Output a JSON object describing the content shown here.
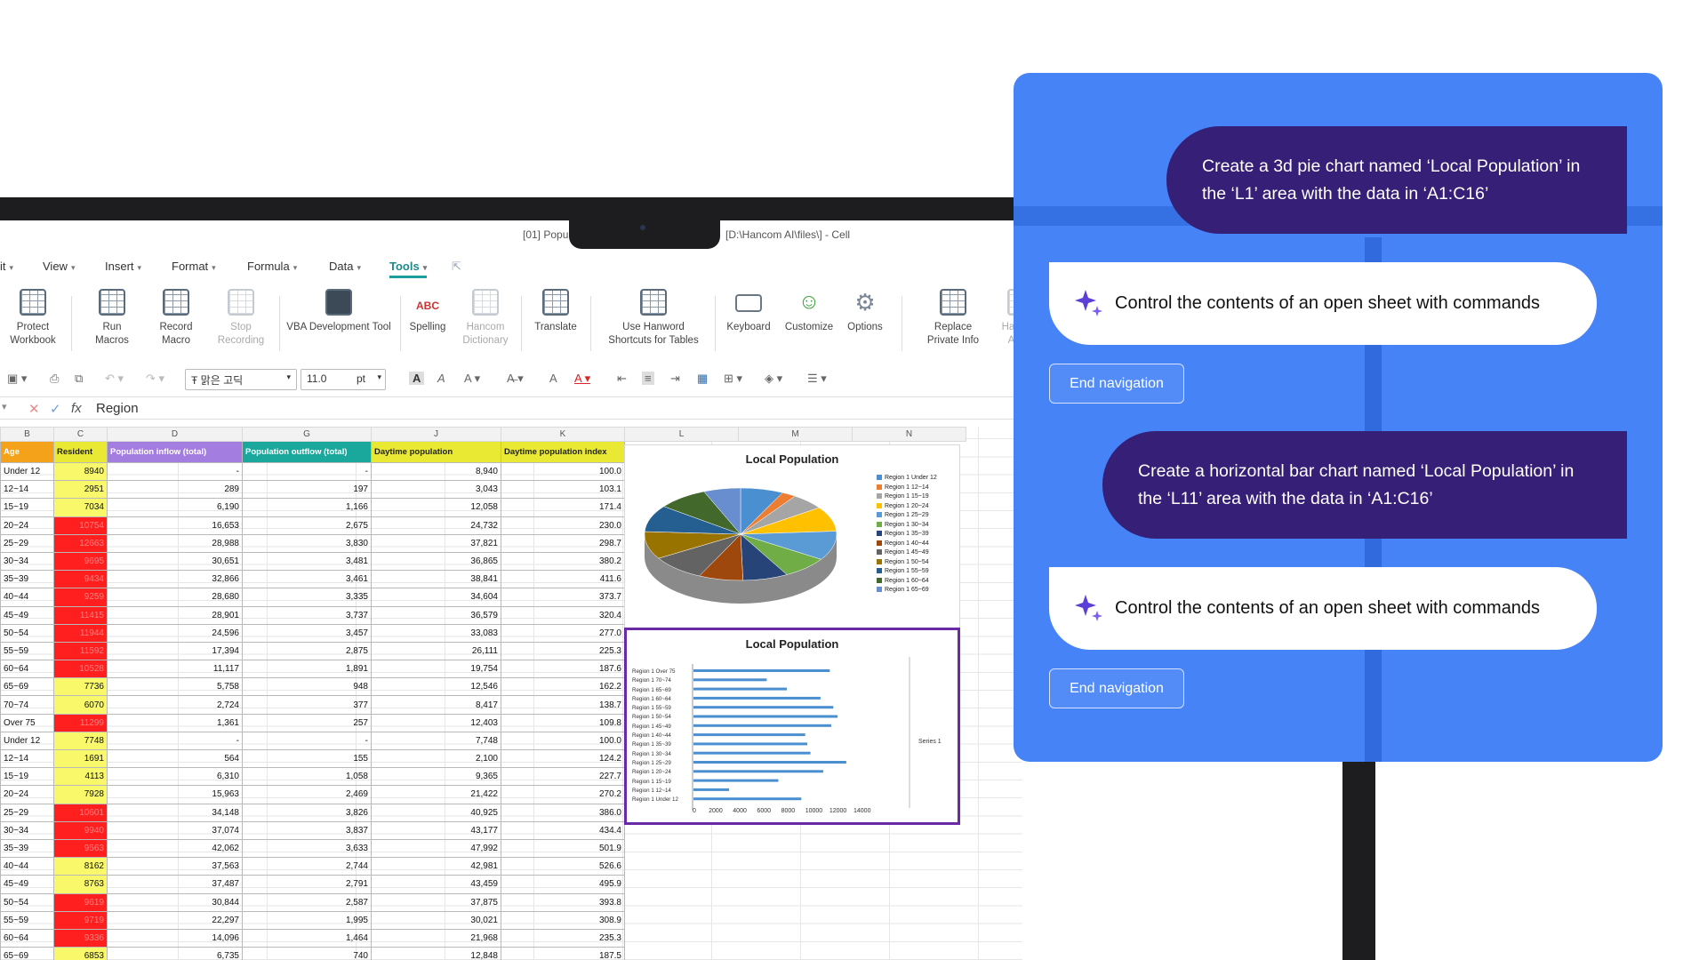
{
  "window": {
    "title_left": "[01] Popu",
    "title_right": "[D:\\Hancom AI\\files\\] - Cell"
  },
  "menu": {
    "items": [
      "it",
      "View",
      "Insert",
      "Format",
      "Formula",
      "Data",
      "Tools"
    ],
    "active": "Tools"
  },
  "ribbon": {
    "protect_workbook": "Protect Workbook",
    "run_macros": "Run Macros",
    "record_macro": "Record Macro",
    "stop_recording": "Stop Recording",
    "vba_tool": "VBA Development Tool",
    "spelling": "Spelling",
    "hancom_dictionary": "Hancom Dictionary",
    "translate": "Translate",
    "hanword_shortcuts": "Use Hanword Shortcuts for Tables",
    "keyboard": "Keyboard",
    "customize": "Customize",
    "options": "Options",
    "replace_private_info": "Replace Private Info",
    "hancom_asset": "Hancom Asset"
  },
  "toolbar": {
    "font_name": "맑은 고딕",
    "font_size": "11.0",
    "font_unit": "pt"
  },
  "formula_bar": {
    "value": "Region"
  },
  "sheet": {
    "column_letters": [
      "B",
      "C",
      "D",
      "G",
      "J",
      "K",
      "L",
      "M",
      "N"
    ],
    "headers": [
      "Age",
      "Resident",
      "Population inflow (total)",
      "Population outflow (total)",
      "Daytime population",
      "Daytime population index"
    ],
    "rows": [
      [
        "Under 12",
        "8940",
        "-",
        "-",
        "8,940",
        "100.0"
      ],
      [
        "12~14",
        "2951",
        "289",
        "197",
        "3,043",
        "103.1"
      ],
      [
        "15~19",
        "7034",
        "6,190",
        "1,166",
        "12,058",
        "171.4"
      ],
      [
        "20~24",
        "10754",
        "16,653",
        "2,675",
        "24,732",
        "230.0"
      ],
      [
        "25~29",
        "12663",
        "28,988",
        "3,830",
        "37,821",
        "298.7"
      ],
      [
        "30~34",
        "9695",
        "30,651",
        "3,481",
        "36,865",
        "380.2"
      ],
      [
        "35~39",
        "9434",
        "32,866",
        "3,461",
        "38,841",
        "411.6"
      ],
      [
        "40~44",
        "9259",
        "28,680",
        "3,335",
        "34,604",
        "373.7"
      ],
      [
        "45~49",
        "11415",
        "28,901",
        "3,737",
        "36,579",
        "320.4"
      ],
      [
        "50~54",
        "11944",
        "24,596",
        "3,457",
        "33,083",
        "277.0"
      ],
      [
        "55~59",
        "11592",
        "17,394",
        "2,875",
        "26,111",
        "225.3"
      ],
      [
        "60~64",
        "10528",
        "11,117",
        "1,891",
        "19,754",
        "187.6"
      ],
      [
        "65~69",
        "7736",
        "5,758",
        "948",
        "12,546",
        "162.2"
      ],
      [
        "70~74",
        "6070",
        "2,724",
        "377",
        "8,417",
        "138.7"
      ],
      [
        "Over 75",
        "11299",
        "1,361",
        "257",
        "12,403",
        "109.8"
      ],
      [
        "Under 12",
        "7748",
        "-",
        "-",
        "7,748",
        "100.0"
      ],
      [
        "12~14",
        "1691",
        "564",
        "155",
        "2,100",
        "124.2"
      ],
      [
        "15~19",
        "4113",
        "6,310",
        "1,058",
        "9,365",
        "227.7"
      ],
      [
        "20~24",
        "7928",
        "15,963",
        "2,469",
        "21,422",
        "270.2"
      ],
      [
        "25~29",
        "10601",
        "34,148",
        "3,826",
        "40,925",
        "386.0"
      ],
      [
        "30~34",
        "9940",
        "37,074",
        "3,837",
        "43,177",
        "434.4"
      ],
      [
        "35~39",
        "9563",
        "42,062",
        "3,633",
        "47,992",
        "501.9"
      ],
      [
        "40~44",
        "8162",
        "37,563",
        "2,744",
        "42,981",
        "526.6"
      ],
      [
        "45~49",
        "8763",
        "37,487",
        "2,791",
        "43,459",
        "495.9"
      ],
      [
        "50~54",
        "9619",
        "30,844",
        "2,587",
        "37,875",
        "393.8"
      ],
      [
        "55~59",
        "9719",
        "22,297",
        "1,995",
        "30,021",
        "308.9"
      ],
      [
        "60~64",
        "9336",
        "14,096",
        "1,464",
        "21,968",
        "235.3"
      ],
      [
        "65~69",
        "6853",
        "6,735",
        "740",
        "12,848",
        "187.5"
      ]
    ],
    "red_resident_rows": [
      3,
      4,
      5,
      6,
      7,
      8,
      9,
      10,
      11,
      14,
      19,
      20,
      21,
      24,
      25,
      26
    ]
  },
  "colors": {
    "age_header": "#f4a21a",
    "resident_header": "#e9e934",
    "inflow_header": "#a47de0",
    "outflow_header": "#1aa89c",
    "daytime_header": "#e9e934",
    "index_header": "#e9e934",
    "highlight_red": "#ff1f1f",
    "panel": "#4583f7",
    "user_bubble": "#351f77",
    "chart_border": "#6a2aa8",
    "bar": "#4a8fcf"
  },
  "pie_chart": {
    "title": "Local Population",
    "legend": [
      "Region 1 Under 12",
      "Region 1 12~14",
      "Region 1 15~19",
      "Region 1 20~24",
      "Region 1 25~29",
      "Region 1 30~34",
      "Region 1 35~39",
      "Region 1 40~44",
      "Region 1 45~49",
      "Region 1 50~54",
      "Region 1 55~59",
      "Region 1 60~64",
      "Region 1 65~69"
    ],
    "legend_colors": [
      "#4a8fcf",
      "#ed7d31",
      "#a5a5a5",
      "#ffc000",
      "#5b9bd5",
      "#70ad47",
      "#264478",
      "#9e480e",
      "#636363",
      "#997300",
      "#255e91",
      "#43682b",
      "#698ed0"
    ]
  },
  "chart_data": {
    "type": "bar",
    "title": "Local Population",
    "categories": [
      "Region 1 Under 12",
      "Region 1 12~14",
      "Region 1 15~19",
      "Region 1 20~24",
      "Region 1 25~29",
      "Region 1 30~34",
      "Region 1 35~39",
      "Region 1 40~44",
      "Region 1 45~49",
      "Region 1 50~54",
      "Region 1 55~59",
      "Region 1 60~64",
      "Region 1 65~69",
      "Region 1 70~74",
      "Region 1 Over 75"
    ],
    "series": [
      {
        "name": "Series 1",
        "values": [
          8940,
          2951,
          7034,
          10754,
          12663,
          9695,
          9434,
          9259,
          11415,
          11944,
          11592,
          10528,
          7736,
          6070,
          11299
        ]
      }
    ],
    "xticks": [
      "0",
      "2000",
      "4000",
      "6000",
      "8000",
      "10000",
      "12000",
      "14000"
    ],
    "xlim": [
      0,
      14000
    ]
  },
  "assistant": {
    "messages": [
      {
        "role": "user",
        "text": "Create a 3d pie chart named ‘Local Population’ in the ‘L1’ area with the data in ‘A1:C16’"
      },
      {
        "role": "ai",
        "text": "Control the contents of an open sheet with commands"
      },
      {
        "role": "user",
        "text": "Create a horizontal bar chart named ‘Local Population’ in the ‘L11’ area with the data in ‘A1:C16’"
      },
      {
        "role": "ai",
        "text": "Control the contents of an open sheet with commands"
      }
    ],
    "end_button": "End navigation"
  }
}
